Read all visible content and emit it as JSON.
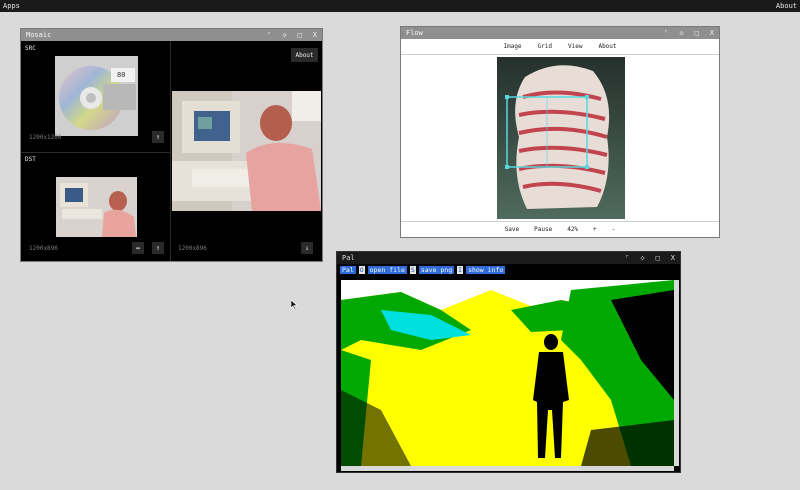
{
  "menubar": {
    "apps": "Apps",
    "about": "About"
  },
  "mosaic": {
    "title": "Mosaic",
    "controls": [
      "⌜",
      "◇",
      "□",
      "X"
    ],
    "about_label": "About",
    "src_label": "SRC",
    "src_dim": "1200x1200",
    "dst_label": "DST",
    "dst_dim": "1200x896",
    "out_dim": "1200x896",
    "upload_icon": "↑",
    "swap_icon": "↔",
    "download_icon": "↓",
    "cd_label": "80"
  },
  "flow": {
    "title": "Flow",
    "controls": [
      "⌜",
      "◇",
      "□",
      "X"
    ],
    "menu": [
      "Image",
      "Grid",
      "View",
      "About"
    ],
    "footer": {
      "save": "Save",
      "pause": "Pause",
      "zoom": "42%",
      "plus": "+",
      "minus": "-"
    }
  },
  "pal": {
    "title": "Pal",
    "controls": [
      "⌜",
      "◇",
      "□",
      "X"
    ],
    "bar_name": "Pal",
    "actions": [
      {
        "key": "O",
        "label": "open file"
      },
      {
        "key": "S",
        "label": "save png"
      },
      {
        "key": "I",
        "label": "show info"
      }
    ]
  },
  "colors": {
    "pal_blue": "#2f6bd8",
    "flow_selection": "#55d8e0",
    "pal_yellow": "#ffff00",
    "pal_green": "#00a800",
    "pal_cyan": "#00e0e0"
  }
}
